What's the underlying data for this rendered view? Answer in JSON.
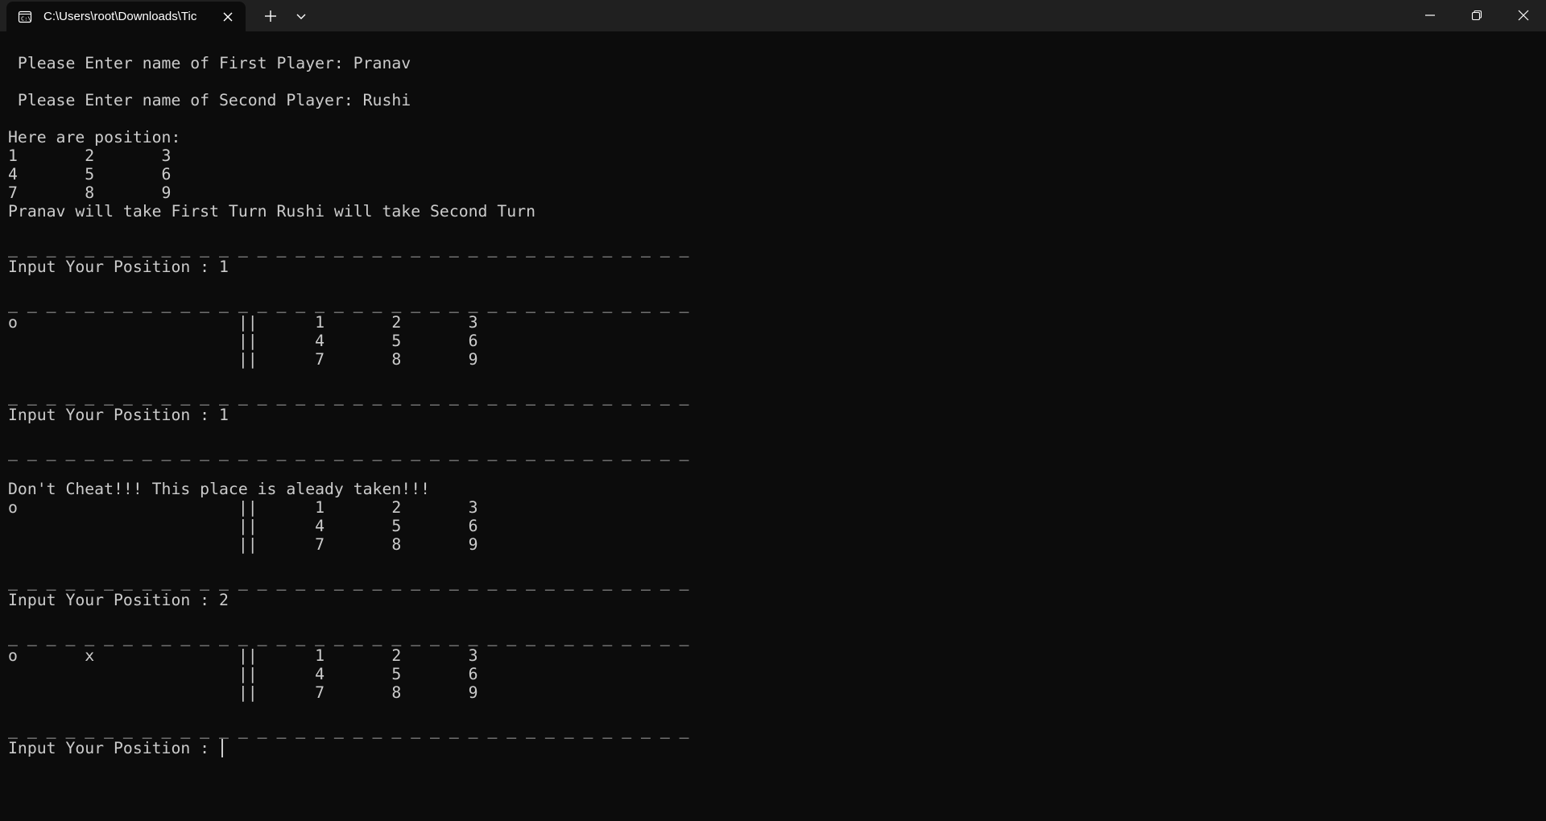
{
  "window": {
    "tab_title": "C:\\Users\\root\\Downloads\\Tic",
    "tab_icon": "terminal-icon",
    "new_tab_icon": "plus-icon",
    "tab_menu_icon": "chevron-down-icon",
    "controls": [
      "minimize-icon",
      "maximize-icon",
      "close-icon"
    ]
  },
  "colors": {
    "titlebar": "#202020",
    "background": "#0c0c0c",
    "text": "#cccccc"
  },
  "terminal": {
    "lines": [
      "",
      " Please Enter name of First Player: Pranav",
      "",
      " Please Enter name of Second Player: Rushi",
      "",
      "Here are position:",
      "1\t2\t3",
      "4\t5\t6",
      "7\t8\t9",
      "Pranav will take First Turn Rushi will take Second Turn",
      "",
      "_ _ _ _ _ _ _ _ _ _ _ _ _ _ _ _ _ _ _ _ _ _ _ _ _ _ _ _ _ _ _ _ _ _ _ _",
      "Input Your Position : 1",
      "",
      "_ _ _ _ _ _ _ _ _ _ _ _ _ _ _ _ _ _ _ _ _ _ _ _ _ _ _ _ _ _ _ _ _ _ _ _",
      "o\t\t\t||\t1\t2\t3",
      "\t\t\t||\t4\t5\t6",
      "\t\t\t||\t7\t8\t9",
      "",
      "_ _ _ _ _ _ _ _ _ _ _ _ _ _ _ _ _ _ _ _ _ _ _ _ _ _ _ _ _ _ _ _ _ _ _ _",
      "Input Your Position : 1",
      "",
      "_ _ _ _ _ _ _ _ _ _ _ _ _ _ _ _ _ _ _ _ _ _ _ _ _ _ _ _ _ _ _ _ _ _ _ _",
      "",
      "Don't Cheat!!! This place is aleady taken!!!",
      "o\t\t\t||\t1\t2\t3",
      "\t\t\t||\t4\t5\t6",
      "\t\t\t||\t7\t8\t9",
      "",
      "_ _ _ _ _ _ _ _ _ _ _ _ _ _ _ _ _ _ _ _ _ _ _ _ _ _ _ _ _ _ _ _ _ _ _ _",
      "Input Your Position : 2",
      "",
      "_ _ _ _ _ _ _ _ _ _ _ _ _ _ _ _ _ _ _ _ _ _ _ _ _ _ _ _ _ _ _ _ _ _ _ _",
      "o\tx\t\t||\t1\t2\t3",
      "\t\t\t||\t4\t5\t6",
      "\t\t\t||\t7\t8\t9",
      "",
      "_ _ _ _ _ _ _ _ _ _ _ _ _ _ _ _ _ _ _ _ _ _ _ _ _ _ _ _ _ _ _ _ _ _ _ _",
      "Input Your Position : "
    ]
  }
}
